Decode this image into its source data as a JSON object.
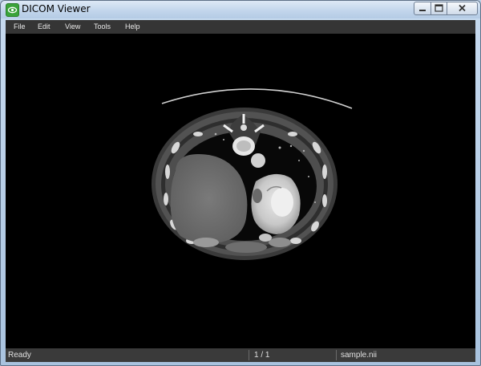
{
  "window": {
    "title": "DICOM Viewer",
    "icon": "eye-icon",
    "controls": {
      "minimize": "minimize-icon",
      "maximize": "maximize-icon",
      "close": "close-icon"
    }
  },
  "menu": {
    "items": [
      "File",
      "Edit",
      "View",
      "Tools",
      "Help"
    ]
  },
  "viewer": {
    "image": "axial-chest-ct-scan"
  },
  "status": {
    "state": "Ready",
    "slice": "1 / 1",
    "file": "sample.nii"
  },
  "colors": {
    "menubar": "#353535",
    "viewport": "#000000",
    "statusbar": "#3a3a3a",
    "titlebar": "#c3d6ec"
  }
}
